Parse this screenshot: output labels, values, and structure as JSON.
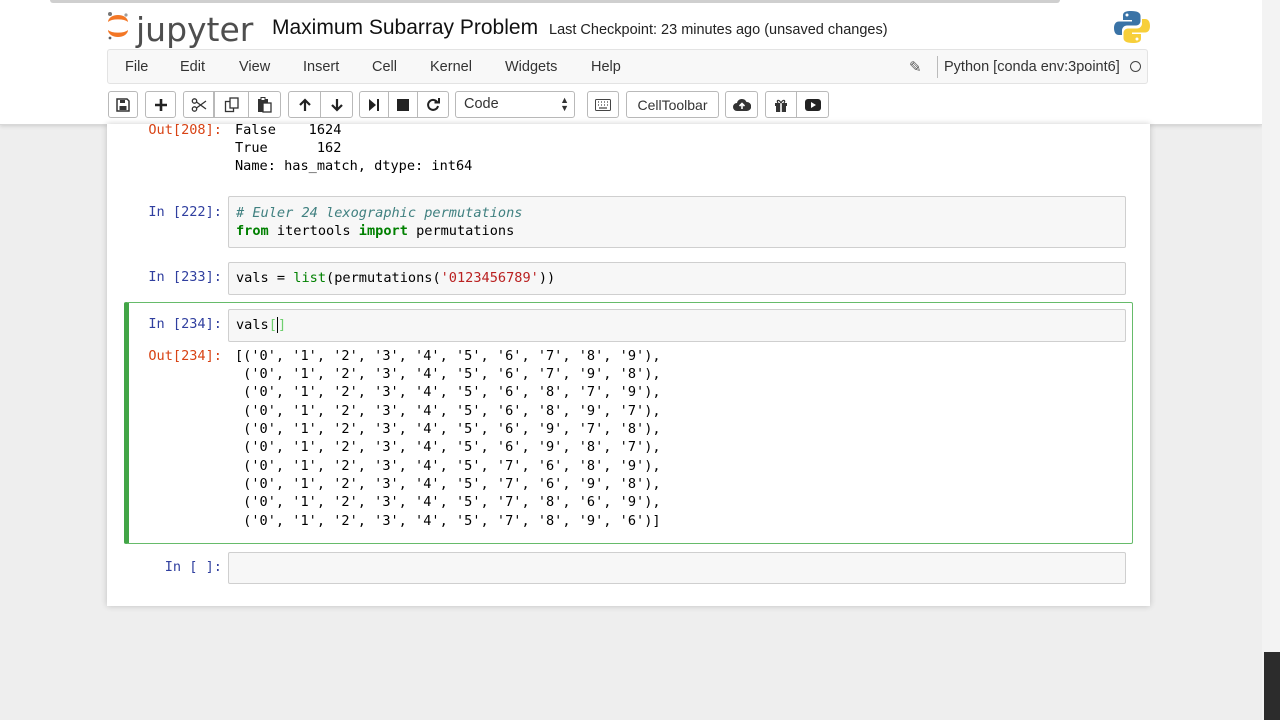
{
  "header": {
    "logo_text": "jupyter",
    "notebook_title": "Maximum Subarray Problem",
    "checkpoint": "Last Checkpoint: 23 minutes ago (unsaved changes)"
  },
  "menubar": {
    "items": [
      "File",
      "Edit",
      "View",
      "Insert",
      "Cell",
      "Kernel",
      "Widgets",
      "Help"
    ],
    "kernel_name": "Python [conda env:3point6]"
  },
  "toolbar": {
    "cell_type": "Code",
    "celltoolbar_label": "CellToolbar",
    "icons": [
      "save-icon",
      "add-cell-icon",
      "cut-icon",
      "copy-icon",
      "paste-icon",
      "move-up-icon",
      "move-down-icon",
      "run-icon",
      "stop-icon",
      "restart-icon",
      "keyboard-icon",
      "upload-icon",
      "gift-icon",
      "present-icon"
    ]
  },
  "cells": [
    {
      "output_prompt": "Out[208]:",
      "output_lines": [
        "False    1624",
        "True      162",
        "Name: has_match, dtype: int64"
      ]
    },
    {
      "input_prompt": "In [222]:",
      "comment": "# Euler 24 lexographic permutations",
      "kw_from": "from",
      "module": " itertools ",
      "kw_import": "import",
      "name": " permutations"
    },
    {
      "input_prompt": "In [233]:",
      "lhs": "vals = ",
      "func_list": "list",
      "call_open": "(permutations(",
      "string": "'0123456789'",
      "call_close": "))"
    },
    {
      "input_prompt": "In [234]:",
      "code": "vals",
      "bracket_open": "[",
      "bracket_close": "]",
      "output_prompt": "Out[234]:",
      "output_lines": [
        "[('0', '1', '2', '3', '4', '5', '6', '7', '8', '9'),",
        " ('0', '1', '2', '3', '4', '5', '6', '7', '9', '8'),",
        " ('0', '1', '2', '3', '4', '5', '6', '8', '7', '9'),",
        " ('0', '1', '2', '3', '4', '5', '6', '8', '9', '7'),",
        " ('0', '1', '2', '3', '4', '5', '6', '9', '7', '8'),",
        " ('0', '1', '2', '3', '4', '5', '6', '9', '8', '7'),",
        " ('0', '1', '2', '3', '4', '5', '7', '6', '8', '9'),",
        " ('0', '1', '2', '3', '4', '5', '7', '6', '9', '8'),",
        " ('0', '1', '2', '3', '4', '5', '7', '8', '6', '9'),",
        " ('0', '1', '2', '3', '4', '5', '7', '8', '9', '6')]"
      ]
    },
    {
      "input_prompt": "In [ ]:"
    }
  ],
  "colors": {
    "input_prompt": "#303F9F",
    "output_prompt": "#D84315",
    "selected_cell_border": "#42a547",
    "keyword": "#008000",
    "string": "#BA2121",
    "comment": "#408080"
  }
}
